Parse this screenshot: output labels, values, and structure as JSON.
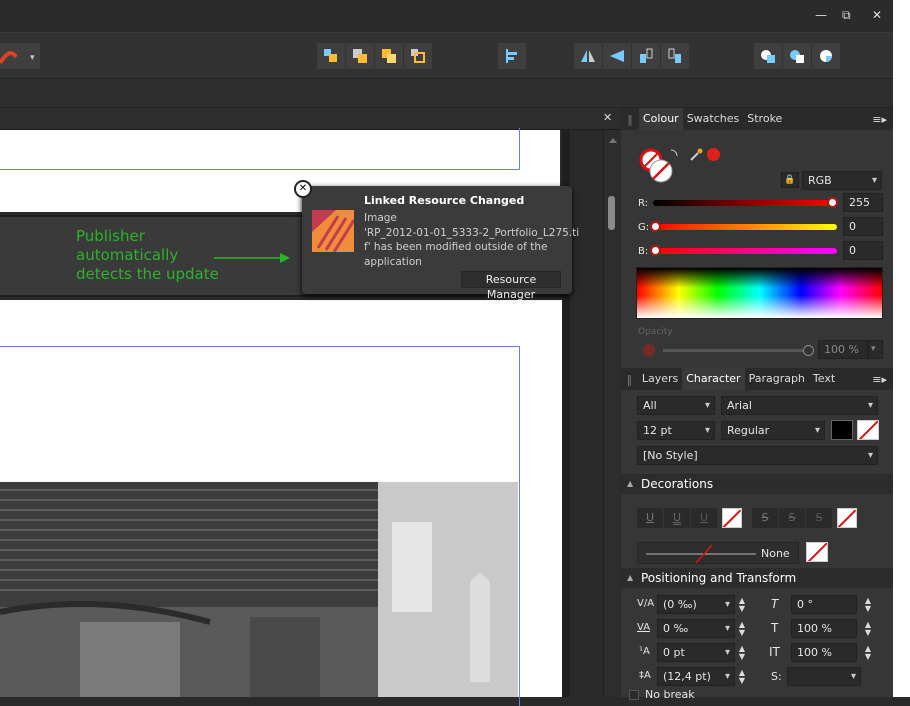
{
  "window": {
    "minimize": "—",
    "restore": "⧉",
    "close": "✕"
  },
  "document": {
    "close_tab": "✕"
  },
  "annotation": {
    "line1": "Publisher",
    "line2": "automatically",
    "line3": "detects the update",
    "color": "#29b529"
  },
  "toast": {
    "title": "Linked Resource Changed",
    "body_line1": "Image",
    "body_line2": "'RP_2012-01-01_5333-2_Portfolio_L275.ti",
    "body_line3": "f' has been modified outside of the",
    "body_line4": "application",
    "button": "Resource Manager",
    "close": "✕"
  },
  "colour_panel": {
    "tabs": [
      "Colour",
      "Swatches",
      "Stroke"
    ],
    "active_tab": "Colour",
    "model": "RGB",
    "r_label": "R:",
    "r_value": "255",
    "g_label": "G:",
    "g_value": "0",
    "b_label": "B:",
    "b_value": "0",
    "opacity_label": "Opacity",
    "opacity_value": "100 %",
    "current_color": "#e0201b"
  },
  "character_panel": {
    "tabs": [
      "Layers",
      "Character",
      "Paragraph",
      "Text Styles"
    ],
    "active_tab": "Character",
    "collection": "All",
    "font": "Arial",
    "size": "12 pt",
    "weight": "Regular",
    "style": "[No Style]",
    "decorations_label": "Decorations",
    "deco_u": [
      "U",
      "U",
      "U"
    ],
    "deco_s": [
      "S",
      "S",
      "S"
    ],
    "line_style": "None",
    "positioning_label": "Positioning and Transform",
    "tracking": "(0 ‰)",
    "kerning": "0 ‰",
    "baseline": "0 pt",
    "leading": "(12,4 pt)",
    "shear": "0 °",
    "vscale": "100 %",
    "hscale": "100 %",
    "script_label": "S:",
    "script_value": "",
    "no_break": "No break"
  }
}
